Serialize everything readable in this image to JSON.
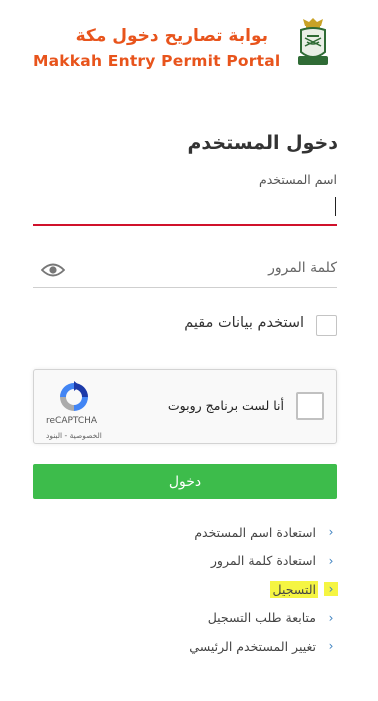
{
  "header": {
    "title_ar": "بوابة تصاريح دخول مكة",
    "title_en": "Makkah Entry Permit Portal",
    "emblem_icon": "saudi-passports-emblem-icon",
    "accent_color": "#e8541c"
  },
  "login": {
    "heading": "دخول المستخدم",
    "username_label": "اسم المستخدم",
    "username_value": "",
    "password_placeholder": "كلمة المرور",
    "eye_icon": "eye-icon",
    "resident_checkbox_label": "استخدم بيانات مقيم",
    "resident_checked": false,
    "submit_label": "دخول",
    "submit_color": "#3dbc4b",
    "error_underline_color": "#d0112b"
  },
  "recaptcha": {
    "label": "أنا لست برنامج روبوت",
    "brand": "reCAPTCHA",
    "terms": "الخصوصية - البنود",
    "checked": false
  },
  "links": [
    {
      "label": "استعادة اسم المستخدم",
      "highlighted": false
    },
    {
      "label": "استعادة كلمة المرور",
      "highlighted": false
    },
    {
      "label": "التسجيل",
      "highlighted": true
    },
    {
      "label": "متابعة طلب التسجيل",
      "highlighted": false
    },
    {
      "label": "تغيير المستخدم الرئيسي",
      "highlighted": false
    }
  ]
}
